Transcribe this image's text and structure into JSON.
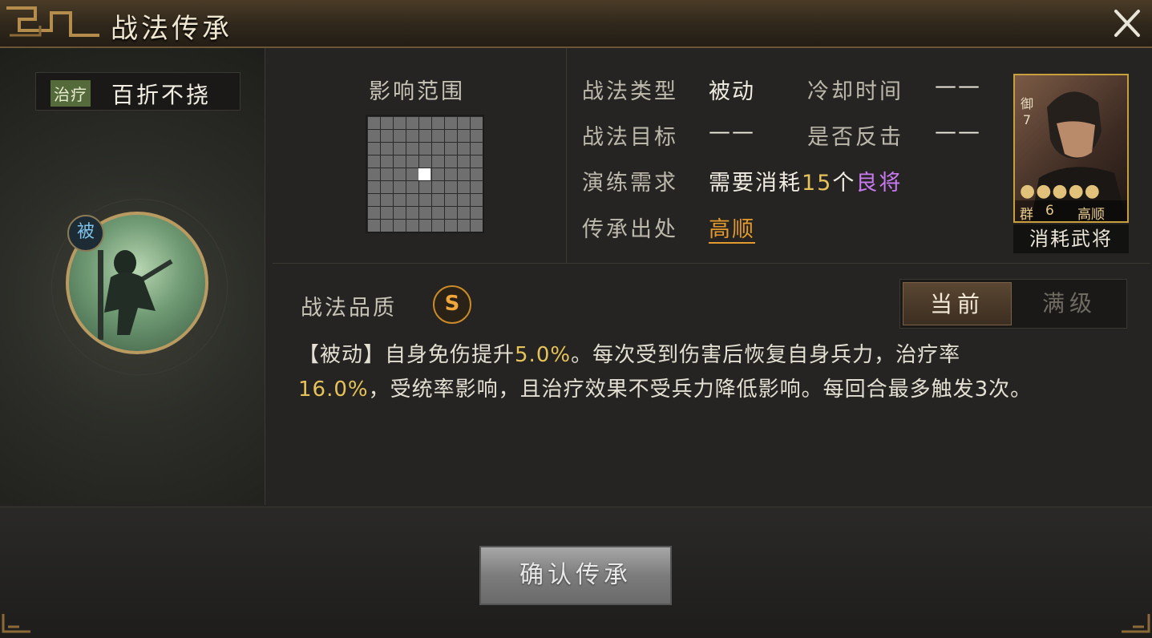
{
  "window": {
    "title": "战法传承"
  },
  "skill": {
    "category_tag": "治疗",
    "name": "百折不挠",
    "passive_badge": "被"
  },
  "range": {
    "label": "影响范围"
  },
  "info": {
    "type_key": "战法类型",
    "type_val": "被动",
    "cooldown_key": "冷却时间",
    "cooldown_val": "——",
    "target_key": "战法目标",
    "target_val": "——",
    "counter_key": "是否反击",
    "counter_val": "——",
    "require_key": "演练需求",
    "require_prefix": "需要消耗",
    "require_count": "15",
    "require_unit": "个",
    "require_item": "良将",
    "source_key": "传承出处",
    "source_val": "高顺"
  },
  "hero_card": {
    "unit_type": "御",
    "unit_level": "7",
    "stars": "●●●●●",
    "faction": "群",
    "cost": "6",
    "name": "高顺",
    "consume_label": "消耗武将"
  },
  "quality": {
    "label": "战法品质",
    "grade": "S"
  },
  "tabs": {
    "current": "当前",
    "max": "满级"
  },
  "description": {
    "p1": "【被动】自身免伤提升",
    "v1": "5.0%",
    "p2": "。每次受到伤害后恢复自身兵力，治疗率",
    "v2": "16.0%",
    "p3": "，受统率影响，且治疗效果不受兵力降低影响。每回合最多触发3次。"
  },
  "actions": {
    "confirm": "确认传承"
  },
  "colors": {
    "accent": "#e6c35a",
    "quality": "#f0a63a",
    "link": "#e39a2c",
    "rarity": "#c879f0"
  }
}
